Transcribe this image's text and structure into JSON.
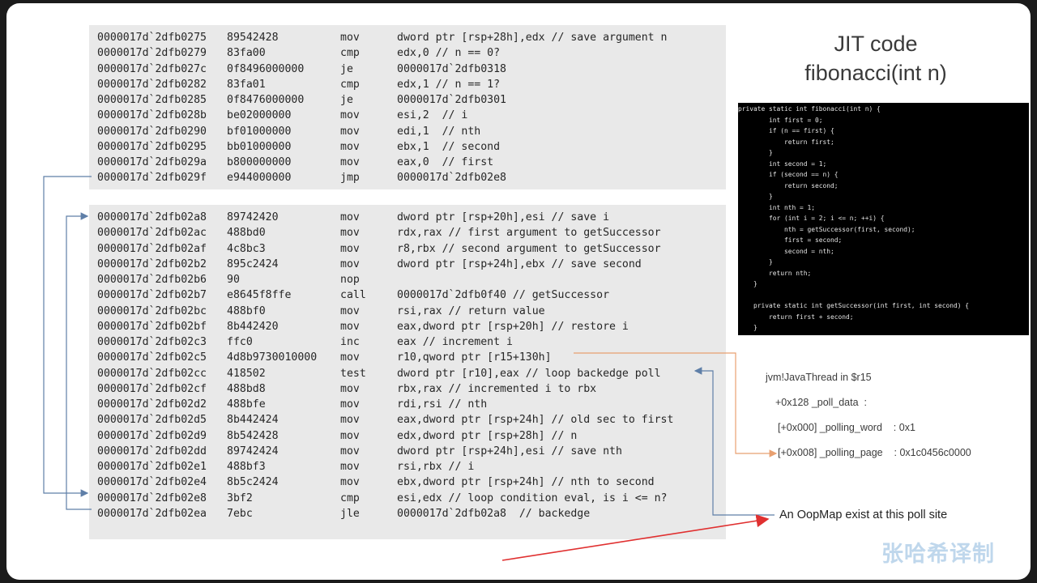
{
  "title": [
    "JIT code",
    "fibonacci(int n)"
  ],
  "asm_block1": [
    {
      "addr": "0000017d`2dfb0275",
      "bytes": "89542428",
      "op": "mov",
      "args": "dword ptr [rsp+28h],edx // save argument n"
    },
    {
      "addr": "0000017d`2dfb0279",
      "bytes": "83fa00",
      "op": "cmp",
      "args": "edx,0 // n == 0?"
    },
    {
      "addr": "0000017d`2dfb027c",
      "bytes": "0f8496000000",
      "op": "je",
      "args": "0000017d`2dfb0318"
    },
    {
      "addr": "0000017d`2dfb0282",
      "bytes": "83fa01",
      "op": "cmp",
      "args": "edx,1 // n == 1?"
    },
    {
      "addr": "0000017d`2dfb0285",
      "bytes": "0f8476000000",
      "op": "je",
      "args": "0000017d`2dfb0301"
    },
    {
      "addr": "0000017d`2dfb028b",
      "bytes": "be02000000",
      "op": "mov",
      "args": "esi,2  // i"
    },
    {
      "addr": "0000017d`2dfb0290",
      "bytes": "bf01000000",
      "op": "mov",
      "args": "edi,1  // nth"
    },
    {
      "addr": "0000017d`2dfb0295",
      "bytes": "bb01000000",
      "op": "mov",
      "args": "ebx,1  // second"
    },
    {
      "addr": "0000017d`2dfb029a",
      "bytes": "b800000000",
      "op": "mov",
      "args": "eax,0  // first"
    },
    {
      "addr": "0000017d`2dfb029f",
      "bytes": "e944000000",
      "op": "jmp",
      "args": "0000017d`2dfb02e8"
    }
  ],
  "asm_block2": [
    {
      "addr": "0000017d`2dfb02a8",
      "bytes": "89742420",
      "op": "mov",
      "args": "dword ptr [rsp+20h],esi // save i"
    },
    {
      "addr": "0000017d`2dfb02ac",
      "bytes": "488bd0",
      "op": "mov",
      "args": "rdx,rax // first argument to getSuccessor"
    },
    {
      "addr": "0000017d`2dfb02af",
      "bytes": "4c8bc3",
      "op": "mov",
      "args": "r8,rbx // second argument to getSuccessor"
    },
    {
      "addr": "0000017d`2dfb02b2",
      "bytes": "895c2424",
      "op": "mov",
      "args": "dword ptr [rsp+24h],ebx // save second"
    },
    {
      "addr": "0000017d`2dfb02b6",
      "bytes": "90",
      "op": "nop",
      "args": ""
    },
    {
      "addr": "0000017d`2dfb02b7",
      "bytes": "e8645f8ffe",
      "op": "call",
      "args": "0000017d`2dfb0f40 // getSuccessor"
    },
    {
      "addr": "0000017d`2dfb02bc",
      "bytes": "488bf0",
      "op": "mov",
      "args": "rsi,rax // return value"
    },
    {
      "addr": "0000017d`2dfb02bf",
      "bytes": "8b442420",
      "op": "mov",
      "args": "eax,dword ptr [rsp+20h] // restore i"
    },
    {
      "addr": "0000017d`2dfb02c3",
      "bytes": "ffc0",
      "op": "inc",
      "args": "eax // increment i"
    },
    {
      "addr": "0000017d`2dfb02c5",
      "bytes": "4d8b9730010000",
      "op": "mov",
      "args": "r10,qword ptr [r15+130h]"
    },
    {
      "addr": "0000017d`2dfb02cc",
      "bytes": "418502",
      "op": "test",
      "args": "dword ptr [r10],eax // loop backedge poll"
    },
    {
      "addr": "0000017d`2dfb02cf",
      "bytes": "488bd8",
      "op": "mov",
      "args": "rbx,rax // incremented i to rbx"
    },
    {
      "addr": "0000017d`2dfb02d2",
      "bytes": "488bfe",
      "op": "mov",
      "args": "rdi,rsi // nth"
    },
    {
      "addr": "0000017d`2dfb02d5",
      "bytes": "8b442424",
      "op": "mov",
      "args": "eax,dword ptr [rsp+24h] // old sec to first"
    },
    {
      "addr": "0000017d`2dfb02d9",
      "bytes": "8b542428",
      "op": "mov",
      "args": "edx,dword ptr [rsp+28h] // n"
    },
    {
      "addr": "0000017d`2dfb02dd",
      "bytes": "89742424",
      "op": "mov",
      "args": "dword ptr [rsp+24h],esi // save nth"
    },
    {
      "addr": "0000017d`2dfb02e1",
      "bytes": "488bf3",
      "op": "mov",
      "args": "rsi,rbx // i"
    },
    {
      "addr": "0000017d`2dfb02e4",
      "bytes": "8b5c2424",
      "op": "mov",
      "args": "ebx,dword ptr [rsp+24h] // nth to second"
    },
    {
      "addr": "0000017d`2dfb02e8",
      "bytes": "3bf2",
      "op": "cmp",
      "args": "esi,edx // loop condition eval, is i <= n?"
    },
    {
      "addr": "0000017d`2dfb02ea",
      "bytes": "7ebc",
      "op": "jle",
      "args": "0000017d`2dfb02a8  // backedge"
    }
  ],
  "java_code": [
    "private static int fibonacci(int n) {",
    "        int first = 0;",
    "        if (n == first) {",
    "            return first;",
    "        }",
    "        int second = 1;",
    "        if (second == n) {",
    "            return second;",
    "        }",
    "        int nth = 1;",
    "        for (int i = 2; i <= n; ++i) {",
    "            nth = getSuccessor(first, second);",
    "            first = second;",
    "            second = nth;",
    "        }",
    "        return nth;",
    "    }",
    "",
    "    private static int getSuccessor(int first, int second) {",
    "        return first + second;",
    "    }"
  ],
  "notes": {
    "thread": "jvm!JavaThread in $r15",
    "poll_data": "+0x128 _poll_data  :",
    "polling_word": "[+0x000] _polling_word    : 0x1",
    "polling_page": "[+0x008] _polling_page    : 0x1c0456c0000",
    "oopmap": "An OopMap exist at this poll site"
  },
  "watermark": "张哈希译制",
  "colors": {
    "orange_arrow": "#e8a070",
    "blue_arrow": "#5f7fa8",
    "red_arrow": "#e03030",
    "code_bg": "#e9e9e9"
  }
}
